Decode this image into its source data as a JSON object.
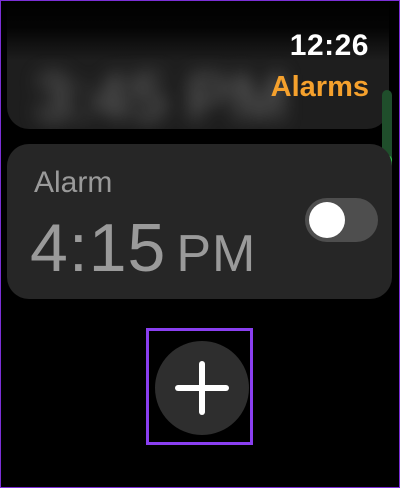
{
  "status": {
    "time": "12:26"
  },
  "header": {
    "title": "Alarms",
    "title_color": "#f5a12d"
  },
  "alarms": [
    {
      "time": "3:45 PM",
      "blurred": true
    },
    {
      "label": "Alarm",
      "time": "4:15",
      "ampm": "PM",
      "enabled": false
    }
  ],
  "scroll": {
    "position": 1.0,
    "track_color": "#1f4e2b",
    "thumb_color": "#32d74b"
  },
  "actions": {
    "add_icon": "plus-icon"
  },
  "highlight_color": "#8a3ff0"
}
